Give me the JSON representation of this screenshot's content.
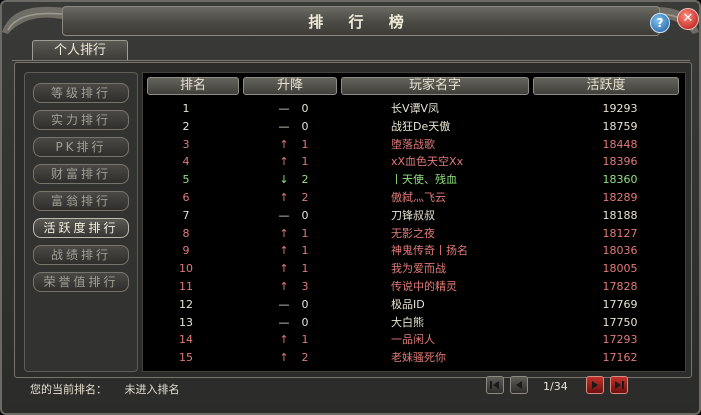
{
  "window": {
    "title": "排 行 榜",
    "help_glyph": "?",
    "close_glyph": "✕"
  },
  "tabs": [
    {
      "label": "个人排行"
    }
  ],
  "sidebar": {
    "items": [
      {
        "label": "等级排行",
        "active": false
      },
      {
        "label": "实力排行",
        "active": false
      },
      {
        "label": "PK排行",
        "active": false
      },
      {
        "label": "财富排行",
        "active": false
      },
      {
        "label": "富翁排行",
        "active": false
      },
      {
        "label": "活跃度排行",
        "active": true
      },
      {
        "label": "战绩排行",
        "active": false
      },
      {
        "label": "荣誉值排行",
        "active": false
      }
    ]
  },
  "table": {
    "headers": {
      "rank": "排名",
      "change": "升降",
      "name": "玩家名字",
      "activity": "活跃度"
    },
    "rows": [
      {
        "rank": "1",
        "trend": "—",
        "delta": "0",
        "name": "长V谭V凤",
        "activity": "19293",
        "color": "#e8e2d0"
      },
      {
        "rank": "2",
        "trend": "—",
        "delta": "0",
        "name": "战狂De天傲",
        "activity": "18759",
        "color": "#e8e2d0"
      },
      {
        "rank": "3",
        "trend": "↑",
        "delta": "1",
        "name": "堕落战歌",
        "activity": "18448",
        "color": "#e07a78"
      },
      {
        "rank": "4",
        "trend": "↑",
        "delta": "1",
        "name": "xX血色天空Xx",
        "activity": "18396",
        "color": "#e07a78"
      },
      {
        "rank": "5",
        "trend": "↓",
        "delta": "2",
        "name": "丨天使、残血",
        "activity": "18360",
        "color": "#8fe07e"
      },
      {
        "rank": "6",
        "trend": "↑",
        "delta": "2",
        "name": "傲弑灬飞云",
        "activity": "18289",
        "color": "#e07a78"
      },
      {
        "rank": "7",
        "trend": "—",
        "delta": "0",
        "name": "刀锋叔叔",
        "activity": "18188",
        "color": "#e8e2d0"
      },
      {
        "rank": "8",
        "trend": "↑",
        "delta": "1",
        "name": "无影之夜",
        "activity": "18127",
        "color": "#e07a78"
      },
      {
        "rank": "9",
        "trend": "↑",
        "delta": "1",
        "name": "神鬼传奇丨扬名",
        "activity": "18036",
        "color": "#e07a78"
      },
      {
        "rank": "10",
        "trend": "↑",
        "delta": "1",
        "name": "我为爱而战",
        "activity": "18005",
        "color": "#e07a78"
      },
      {
        "rank": "11",
        "trend": "↑",
        "delta": "3",
        "name": "传说中的精灵",
        "activity": "17828",
        "color": "#e07a78"
      },
      {
        "rank": "12",
        "trend": "—",
        "delta": "0",
        "name": "极品ID",
        "activity": "17769",
        "color": "#e8e2d0"
      },
      {
        "rank": "13",
        "trend": "—",
        "delta": "0",
        "name": "大白熊",
        "activity": "17750",
        "color": "#e8e2d0"
      },
      {
        "rank": "14",
        "trend": "↑",
        "delta": "1",
        "name": "一品闲人",
        "activity": "17293",
        "color": "#e07a78"
      },
      {
        "rank": "15",
        "trend": "↑",
        "delta": "2",
        "name": "老妹骚死你",
        "activity": "17162",
        "color": "#e07a78"
      }
    ]
  },
  "footer": {
    "current_rank_label": "您的当前排名：",
    "current_rank_value": "未进入排名"
  },
  "pagination": {
    "page_text": "1/34"
  },
  "colors": {
    "up": "#e07a78",
    "down": "#8fe07e",
    "flat": "#e8e2d0"
  }
}
